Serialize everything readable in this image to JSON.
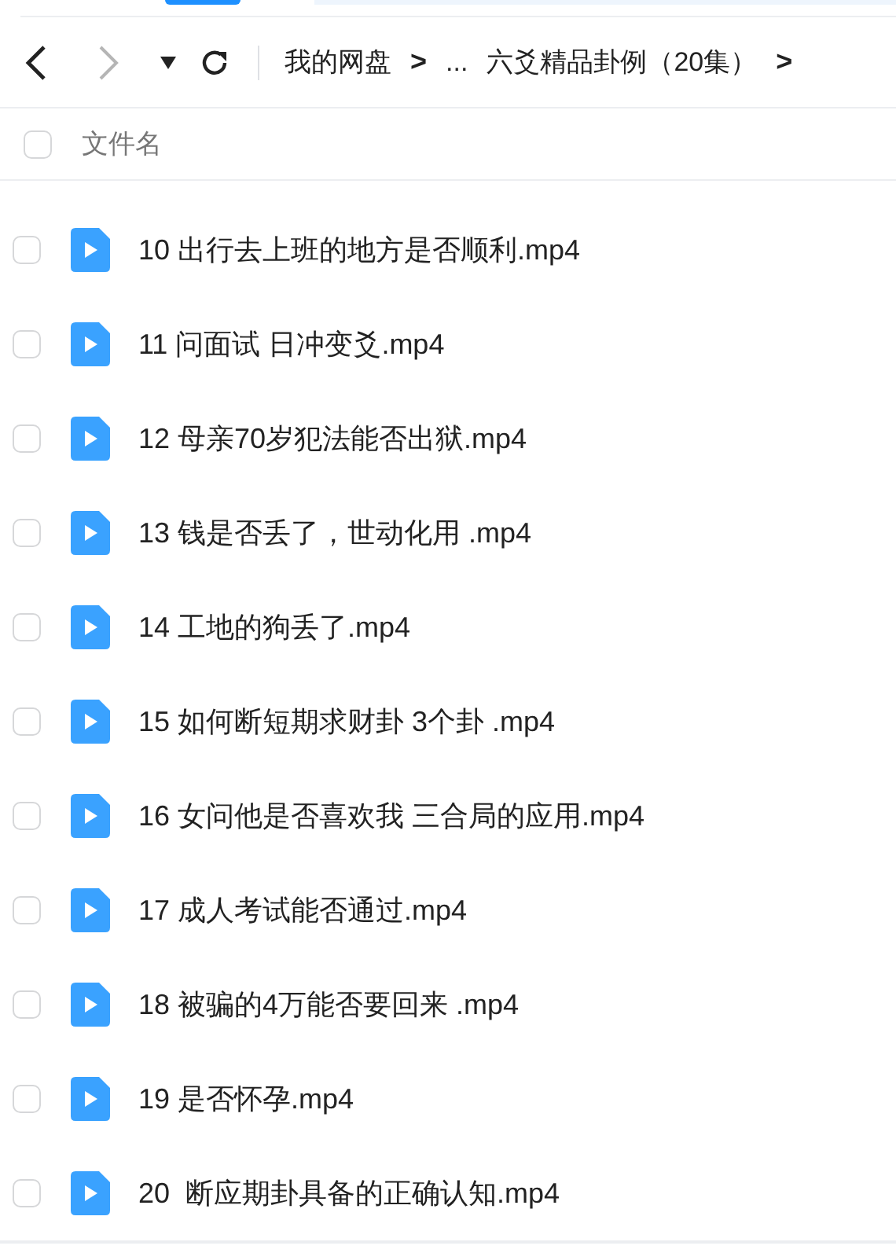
{
  "breadcrumb": [
    {
      "kind": "crumb",
      "text": "我的网盘"
    },
    {
      "kind": "sep",
      "text": ">"
    },
    {
      "kind": "crumb",
      "text": "..."
    },
    {
      "kind": "crumb",
      "text": "六爻精品卦例（20集）"
    },
    {
      "kind": "sep",
      "text": ">"
    }
  ],
  "nav": {
    "back_disabled": false,
    "forward_disabled": true
  },
  "header": {
    "checked": false,
    "label": "文件名"
  },
  "files": [
    {
      "name": "10 出行去上班的地方是否顺利.mp4",
      "checked": false
    },
    {
      "name": "11 问面试 日冲变爻.mp4",
      "checked": false
    },
    {
      "name": "12 母亲70岁犯法能否出狱.mp4",
      "checked": false
    },
    {
      "name": "13 钱是否丢了，世动化用 .mp4",
      "checked": false
    },
    {
      "name": "14 工地的狗丢了.mp4",
      "checked": false
    },
    {
      "name": "15 如何断短期求财卦 3个卦 .mp4",
      "checked": false
    },
    {
      "name": "16 女问他是否喜欢我 三合局的应用.mp4",
      "checked": false
    },
    {
      "name": "17 成人考试能否通过.mp4",
      "checked": false
    },
    {
      "name": "18 被骗的4万能否要回来 .mp4",
      "checked": false
    },
    {
      "name": "19 是否怀孕.mp4",
      "checked": false
    },
    {
      "name": "20  断应期卦具备的正确认知.mp4",
      "checked": false
    }
  ]
}
